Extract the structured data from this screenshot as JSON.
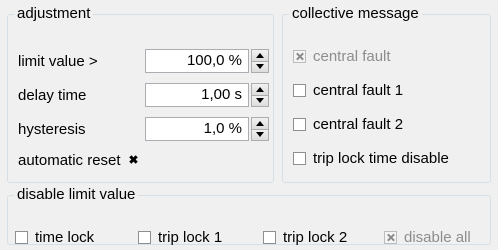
{
  "adjustment": {
    "title": "adjustment",
    "limit_value": {
      "label": "limit value >",
      "value": "100,0 %"
    },
    "delay_time": {
      "label": "delay time",
      "value": "1,00 s"
    },
    "hysteresis": {
      "label": "hysteresis",
      "value": "1,0 %"
    },
    "automatic_reset": {
      "label": "automatic reset",
      "checked": true
    }
  },
  "collective_message": {
    "title": "collective message",
    "items": [
      {
        "label": "central fault",
        "checked": true,
        "enabled": false
      },
      {
        "label": "central fault 1",
        "checked": false,
        "enabled": true
      },
      {
        "label": "central fault 2",
        "checked": false,
        "enabled": true
      },
      {
        "label": "trip lock time disable",
        "checked": false,
        "enabled": true
      }
    ]
  },
  "disable_limit_value": {
    "title": "disable limit value",
    "items": [
      {
        "label": "time lock",
        "checked": false,
        "enabled": true
      },
      {
        "label": "trip lock 1",
        "checked": false,
        "enabled": true
      },
      {
        "label": "trip lock 2",
        "checked": false,
        "enabled": true
      },
      {
        "label": "disable all",
        "checked": true,
        "enabled": false
      }
    ]
  }
}
